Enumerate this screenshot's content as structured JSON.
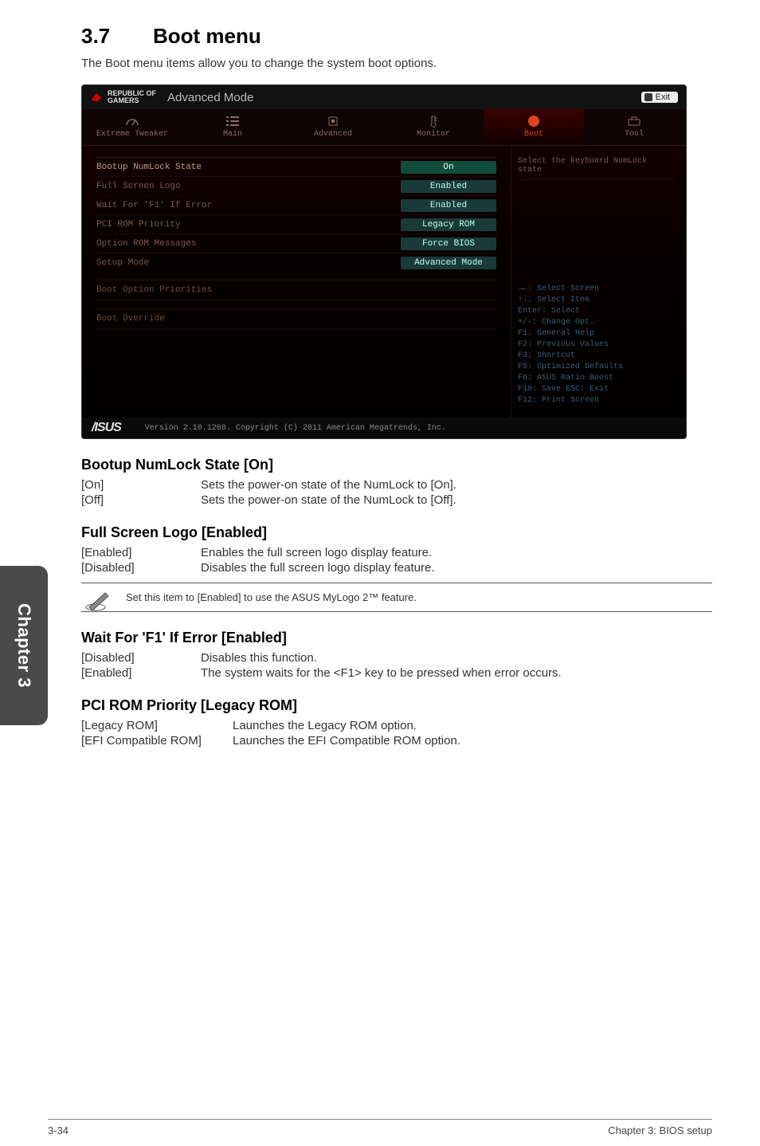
{
  "header": {
    "section_num": "3.7",
    "section_title": "Boot menu",
    "intro": "The Boot menu items allow you to change the system boot options."
  },
  "bios": {
    "brand_line1": "REPUBLIC OF",
    "brand_line2": "GAMERS",
    "mode": "Advanced Mode",
    "exit_label": "Exit",
    "tabs": [
      {
        "label": "Extreme Tweaker"
      },
      {
        "label": "Main"
      },
      {
        "label": "Advanced"
      },
      {
        "label": "Monitor"
      },
      {
        "label": "Boot"
      },
      {
        "label": "Tool"
      }
    ],
    "rows": [
      {
        "label": "Bootup NumLock State",
        "value": "On"
      },
      {
        "label": "Full Screen Logo",
        "value": "Enabled"
      },
      {
        "label": "Wait For 'F1' If Error",
        "value": "Enabled"
      },
      {
        "label": "PCI ROM Priority",
        "value": "Legacy ROM"
      },
      {
        "label": "Option ROM Messages",
        "value": "Force BIOS"
      },
      {
        "label": "Setup Mode",
        "value": "Advanced Mode"
      }
    ],
    "section_header1": "Boot Option Priorities",
    "section_header2": "Boot Override",
    "help_title": "Select the keyboard NumLock state",
    "keyhelp": [
      "→←: Select Screen",
      "↑↓: Select Item",
      "Enter: Select",
      "+/-: Change Opt.",
      "F1: General Help",
      "F2: Previous Values",
      "F3: Shortcut",
      "F5: Optimized Defaults",
      "F6: ASUS Ratio Boost",
      "F10: Save  ESC: Exit",
      "F12: Print Screen"
    ],
    "footer_logo": "/ISUS",
    "footer_text": "Version 2.10.1208. Copyright (C) 2011 American Megatrends, Inc."
  },
  "body": {
    "items": [
      {
        "title": "Bootup NumLock State [On]",
        "opts": [
          {
            "key": "[On]",
            "desc": "Sets the power-on state of the NumLock to [On]."
          },
          {
            "key": "[Off]",
            "desc": "Sets the power-on state of the NumLock to [Off]."
          }
        ]
      },
      {
        "title": "Full Screen Logo [Enabled]",
        "opts": [
          {
            "key": "[Enabled]",
            "desc": "Enables the full screen logo display feature."
          },
          {
            "key": "[Disabled]",
            "desc": "Disables the full screen logo display feature."
          }
        ],
        "note": "Set this item to [Enabled] to use the ASUS MyLogo 2™ feature."
      },
      {
        "title": "Wait For 'F1' If Error [Enabled]",
        "opts": [
          {
            "key": "[Disabled]",
            "desc": "Disables this function."
          },
          {
            "key": "[Enabled]",
            "desc": "The system waits for the <F1> key to be pressed when error occurs."
          }
        ]
      },
      {
        "title": "PCI ROM Priority [Legacy ROM]",
        "wide": true,
        "opts": [
          {
            "key": "[Legacy ROM]",
            "desc": "Launches the Legacy ROM option."
          },
          {
            "key": "[EFI Compatible ROM]",
            "desc": "Launches the EFI Compatible ROM option."
          }
        ]
      }
    ]
  },
  "sidetab": "Chapter 3",
  "footer": {
    "left": "3-34",
    "right": "Chapter 3: BIOS setup"
  }
}
